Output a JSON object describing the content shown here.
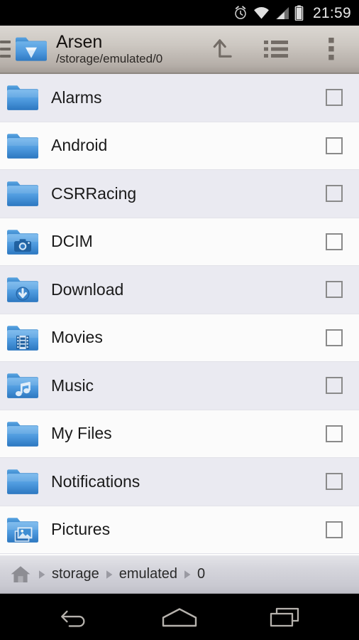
{
  "status_bar": {
    "alarm_icon": "alarm-clock-icon",
    "wifi_icon": "wifi-icon",
    "signal_icon": "cellular-signal-icon",
    "battery_icon": "battery-icon",
    "clock": "21:59"
  },
  "toolbar": {
    "drawer_icon": "hamburger-menu-icon",
    "folder_icon": "diamond-folder-icon",
    "title": "Arsen",
    "subtitle": "/storage/emulated/0",
    "actions": [
      {
        "name": "navigate-up-button",
        "icon": "arrow-up-left-icon",
        "label": "Up"
      },
      {
        "name": "view-mode-button",
        "icon": "list-view-icon",
        "label": "List view"
      },
      {
        "name": "overflow-menu-button",
        "icon": "more-vertical-icon",
        "label": "More options"
      }
    ]
  },
  "file_list": {
    "items": [
      {
        "name": "Alarms",
        "icon": "folder-icon"
      },
      {
        "name": "Android",
        "icon": "folder-icon"
      },
      {
        "name": "CSRRacing",
        "icon": "folder-icon"
      },
      {
        "name": "DCIM",
        "icon": "folder-camera-icon"
      },
      {
        "name": "Download",
        "icon": "folder-download-icon"
      },
      {
        "name": "Movies",
        "icon": "folder-film-icon"
      },
      {
        "name": "Music",
        "icon": "folder-music-icon"
      },
      {
        "name": "My Files",
        "icon": "folder-icon"
      },
      {
        "name": "Notifications",
        "icon": "folder-icon"
      },
      {
        "name": "Pictures",
        "icon": "folder-image-icon"
      }
    ],
    "checkbox_state": "unchecked"
  },
  "breadcrumb": {
    "home_icon": "home-icon",
    "separator": "▶",
    "segments": [
      "storage",
      "emulated",
      "0"
    ]
  },
  "nav_bar": {
    "buttons": [
      {
        "name": "back-button",
        "icon": "back-arrow-icon"
      },
      {
        "name": "home-button",
        "icon": "home-pentagon-icon"
      },
      {
        "name": "recents-button",
        "icon": "recents-icon"
      }
    ]
  },
  "colors": {
    "folder_blue": "#3f8fd8",
    "folder_blue_light": "#6fb4e8",
    "toolbar_top": "#dbd7d2",
    "toolbar_bottom": "#a49d97",
    "row_alt": "#eaeaf1",
    "row_plain": "#fbfbfb",
    "status_bg": "#000000"
  }
}
